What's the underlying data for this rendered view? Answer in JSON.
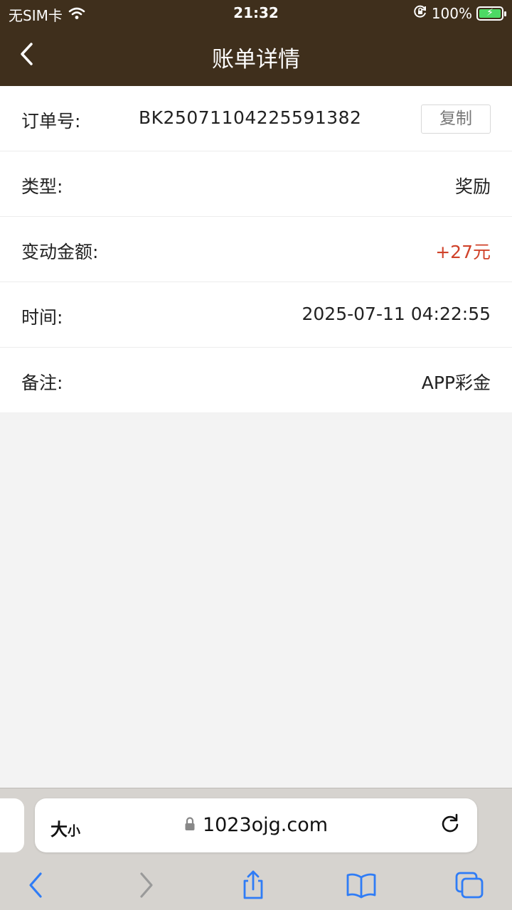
{
  "status_bar": {
    "carrier": "无SIM卡",
    "time": "21:32",
    "battery": "100%"
  },
  "nav": {
    "title": "账单详情",
    "back_icon": "chevron-left-icon"
  },
  "details": {
    "order": {
      "label": "订单号:",
      "value": "BK25071104225591382",
      "copy_label": "复制"
    },
    "type": {
      "label": "类型:",
      "value": "奖励"
    },
    "amount": {
      "label": "变动金额:",
      "value": "+27元",
      "color": "#d0422a"
    },
    "time": {
      "label": "时间:",
      "value": "2025-07-11 04:22:55"
    },
    "note": {
      "label": "备注:",
      "value": "APP彩金"
    }
  },
  "browser": {
    "text_size_big": "大",
    "text_size_small": "小",
    "url": "1023ojg.com",
    "accent": "#2f7cf6"
  }
}
